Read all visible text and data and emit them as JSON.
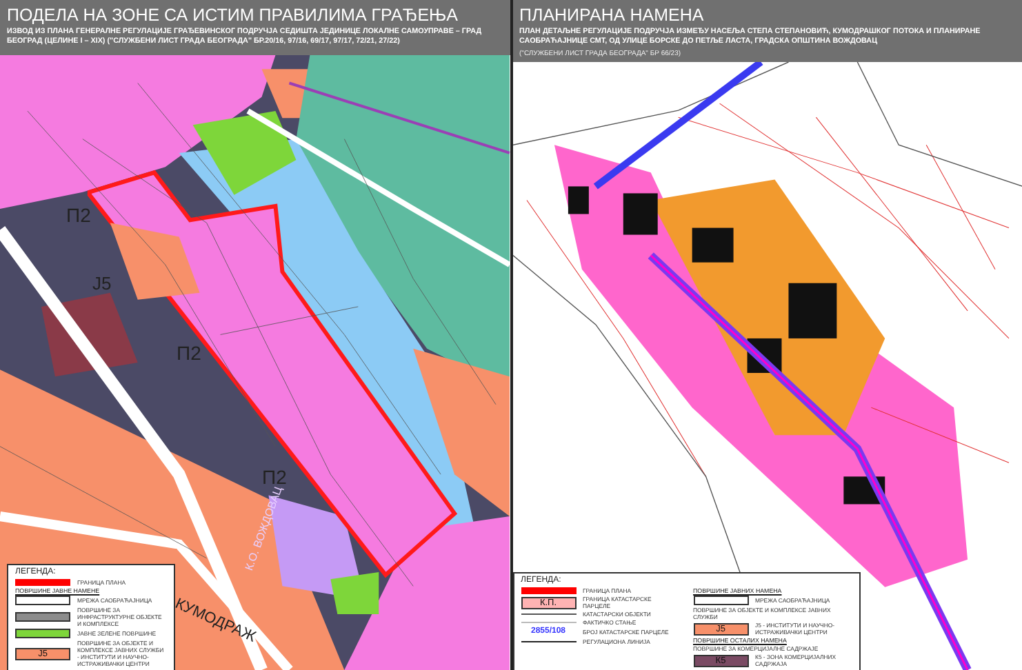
{
  "panels": [
    {
      "title": "ПОДЕЛА НА ЗОНЕ СА ИСТИМ ПРАВИЛИМА ГРАЂЕЊА",
      "subtitle": "ИЗВОД ИЗ ПЛАНА ГЕНЕРАЛНЕ РЕГУЛАЦИЈЕ ГРАЂЕВИНСКОГ ПОДРУЧЈА СЕДИШТА ЈЕДИНИЦЕ ЛОКАЛНЕ САМОУПРАВЕ – ГРАД БЕОГРАД (ЦЕЛИНЕ I – XIX) (\"СЛУЖБЕНИ ЛИСТ ГРАДА БЕОГРАДА\" БР.20/16, 97/16, 69/17, 97/17, 72/21, 27/22)",
      "map_labels": [
        {
          "text": "П2"
        },
        {
          "text": "Ј5"
        },
        {
          "text": "П2"
        },
        {
          "text": "П2"
        },
        {
          "text": "КУМОДРАЖ"
        },
        {
          "text": "К.О. ВОЖДОВАЦ"
        }
      ],
      "legend": {
        "title": "ЛЕГЕНДА:",
        "columns": [
          [
            {
              "kind": "line",
              "color": "#ff0000",
              "label": "ГРАНИЦА ПЛАНА"
            },
            {
              "kind": "heading",
              "label": "ПОВРШИНЕ ЈАВНЕ НАМЕНЕ"
            },
            {
              "kind": "swatch",
              "color": "#ffffff",
              "label": "МРЕЖА САОБРАЋАЈНИЦА"
            },
            {
              "kind": "swatch",
              "color": "#8c8c8c",
              "label": "ПОВРШИНЕ ЗА ИНФРАСТРУКТУРНЕ ОБЈЕКТЕ И КОМПЛЕКСЕ"
            },
            {
              "kind": "swatch",
              "color": "#7ed63a",
              "label": "ЈАВНЕ ЗЕЛЕНЕ ПОВРШИНЕ"
            },
            {
              "kind": "swatch",
              "color": "#f7906a",
              "code": "Ј5",
              "label": "ПОВРШИНЕ ЗА ОБЈЕКТЕ И КОМПЛЕКСЕ ЈАВНИХ СЛУЖБИ - ИНСТИТУТИ И НАУЧНО-ИСТРАЖИВАЧКИ ЦЕНТРИ"
            }
          ]
        ]
      }
    },
    {
      "title": "ПЛАНИРАНА НАМЕНА",
      "subtitle": "ПЛАН ДЕТАЉНЕ РЕГУЛАЦИЈЕ ПОДРУЧЈА ИЗМЕЂУ НАСЕЉА СТЕПА СТЕПАНОВИЋ, КУМОДРАШКОГ ПОТОКА И ПЛАНИРАНЕ САОБРАЋАЈНИЦЕ СМТ, ОД УЛИЦЕ БОРСКЕ ДО ПЕТЉЕ ЛАСТА, ГРАДСКА ОПШТИНА ВОЖДОВАЦ",
      "note": "(\"СЛУЖБЕНИ ЛИСТ ГРАДА БЕОГРАДА\" БР 66/23)",
      "legend": {
        "title": "ЛЕГЕНДА:",
        "columns": [
          [
            {
              "kind": "line",
              "color": "#ff0000",
              "label": "ГРАНИЦА ПЛАНА"
            },
            {
              "kind": "swatch",
              "color": "#ffb3b3",
              "code": "К.П.",
              "label": "ГРАНИЦА КАТАСТАРСКЕ ПАРЦЕЛЕ"
            },
            {
              "kind": "line",
              "color": "#555555",
              "label": "КАТАСТАРСКИ ОБЈЕКТИ"
            },
            {
              "kind": "line",
              "color": "#bbbbbb",
              "label": "ФАКТИЧКО СТАЊЕ"
            },
            {
              "kind": "number",
              "color": "#3333ff",
              "code": "2855/108",
              "label": "БРОЈ КАТАСТАРСКЕ ПАРЦЕЛЕ"
            },
            {
              "kind": "line",
              "color": "#222222",
              "label": "РЕГУЛАЦИОНА ЛИНИЈА"
            }
          ],
          [
            {
              "kind": "heading",
              "label": "ПОВРШИНЕ ЈАВНИХ НАМЕНА"
            },
            {
              "kind": "swatch",
              "color": "#ffffff",
              "label": "МРЕЖА САОБРАЋАЈНИЦА"
            },
            {
              "kind": "subheading",
              "label": "ПОВРШИНЕ ЗА ОБЈЕКТЕ И КОМПЛЕКСЕ ЈАВНИХ СЛУЖБИ"
            },
            {
              "kind": "swatch",
              "color": "#f7906a",
              "code": "Ј5",
              "label": "Ј5 - ИНСТИТУТИ И НАУЧНО- ИСТРАЖИВАЧКИ ЦЕНТРИ"
            },
            {
              "kind": "heading",
              "label": "ПОВРШИНЕ ОСТАЛИХ НАМЕНА"
            },
            {
              "kind": "subheading",
              "label": "ПОВРШИНЕ ЗА КОМЕРЦИЈАЛНЕ САДРЖАЈЕ"
            },
            {
              "kind": "swatch",
              "color": "#7a4a63",
              "code": "К5",
              "label": "К5 - ЗОНА КОМЕРЦИЈАЛНИХ САДРЖАЈА"
            }
          ]
        ]
      }
    }
  ]
}
